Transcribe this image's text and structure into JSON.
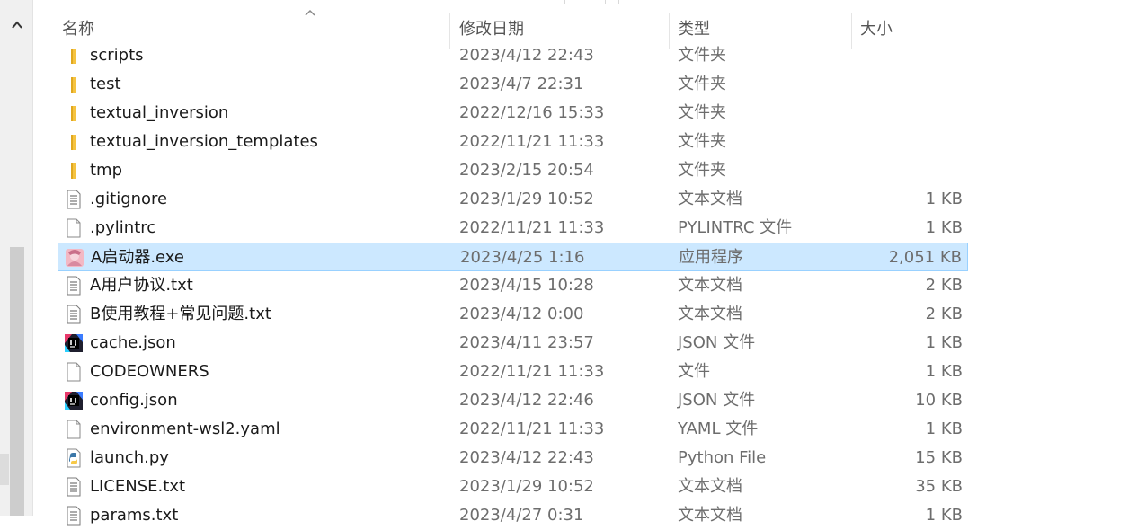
{
  "header": {
    "name": "名称",
    "date": "修改日期",
    "type": "类型",
    "size": "大小"
  },
  "files": [
    {
      "name": "scripts",
      "date": "2023/4/12 22:43",
      "type": "文件夹",
      "size": "",
      "icon": "folder-icon"
    },
    {
      "name": "test",
      "date": "2023/4/7 22:31",
      "type": "文件夹",
      "size": "",
      "icon": "folder-icon"
    },
    {
      "name": "textual_inversion",
      "date": "2022/12/16 15:33",
      "type": "文件夹",
      "size": "",
      "icon": "folder-icon"
    },
    {
      "name": "textual_inversion_templates",
      "date": "2022/11/21 11:33",
      "type": "文件夹",
      "size": "",
      "icon": "folder-icon"
    },
    {
      "name": "tmp",
      "date": "2023/2/15 20:54",
      "type": "文件夹",
      "size": "",
      "icon": "folder-icon"
    },
    {
      "name": ".gitignore",
      "date": "2023/1/29 10:52",
      "type": "文本文档",
      "size": "1 KB",
      "icon": "text-file-icon"
    },
    {
      "name": ".pylintrc",
      "date": "2022/11/21 11:33",
      "type": "PYLINTRC 文件",
      "size": "1 KB",
      "icon": "blank-file-icon"
    },
    {
      "name": "A启动器.exe",
      "date": "2023/4/25 1:16",
      "type": "应用程序",
      "size": "2,051 KB",
      "icon": "app-icon",
      "selected": true
    },
    {
      "name": "A用户协议.txt",
      "date": "2023/4/15 10:28",
      "type": "文本文档",
      "size": "2 KB",
      "icon": "text-file-icon"
    },
    {
      "name": "B使用教程+常见问题.txt",
      "date": "2023/4/12 0:00",
      "type": "文本文档",
      "size": "2 KB",
      "icon": "text-file-icon"
    },
    {
      "name": "cache.json",
      "date": "2023/4/11 23:57",
      "type": "JSON 文件",
      "size": "1 KB",
      "icon": "json-file-icon"
    },
    {
      "name": "CODEOWNERS",
      "date": "2022/11/21 11:33",
      "type": "文件",
      "size": "1 KB",
      "icon": "blank-file-icon"
    },
    {
      "name": "config.json",
      "date": "2023/4/12 22:46",
      "type": "JSON 文件",
      "size": "10 KB",
      "icon": "json-file-icon"
    },
    {
      "name": "environment-wsl2.yaml",
      "date": "2022/11/21 11:33",
      "type": "YAML 文件",
      "size": "1 KB",
      "icon": "blank-file-icon"
    },
    {
      "name": "launch.py",
      "date": "2023/4/12 22:43",
      "type": "Python File",
      "size": "15 KB",
      "icon": "python-file-icon"
    },
    {
      "name": "LICENSE.txt",
      "date": "2023/1/29 10:52",
      "type": "文本文档",
      "size": "35 KB",
      "icon": "text-file-icon"
    },
    {
      "name": "params.txt",
      "date": "2023/4/27 0:31",
      "type": "文本文档",
      "size": "1 KB",
      "icon": "text-file-icon"
    }
  ]
}
